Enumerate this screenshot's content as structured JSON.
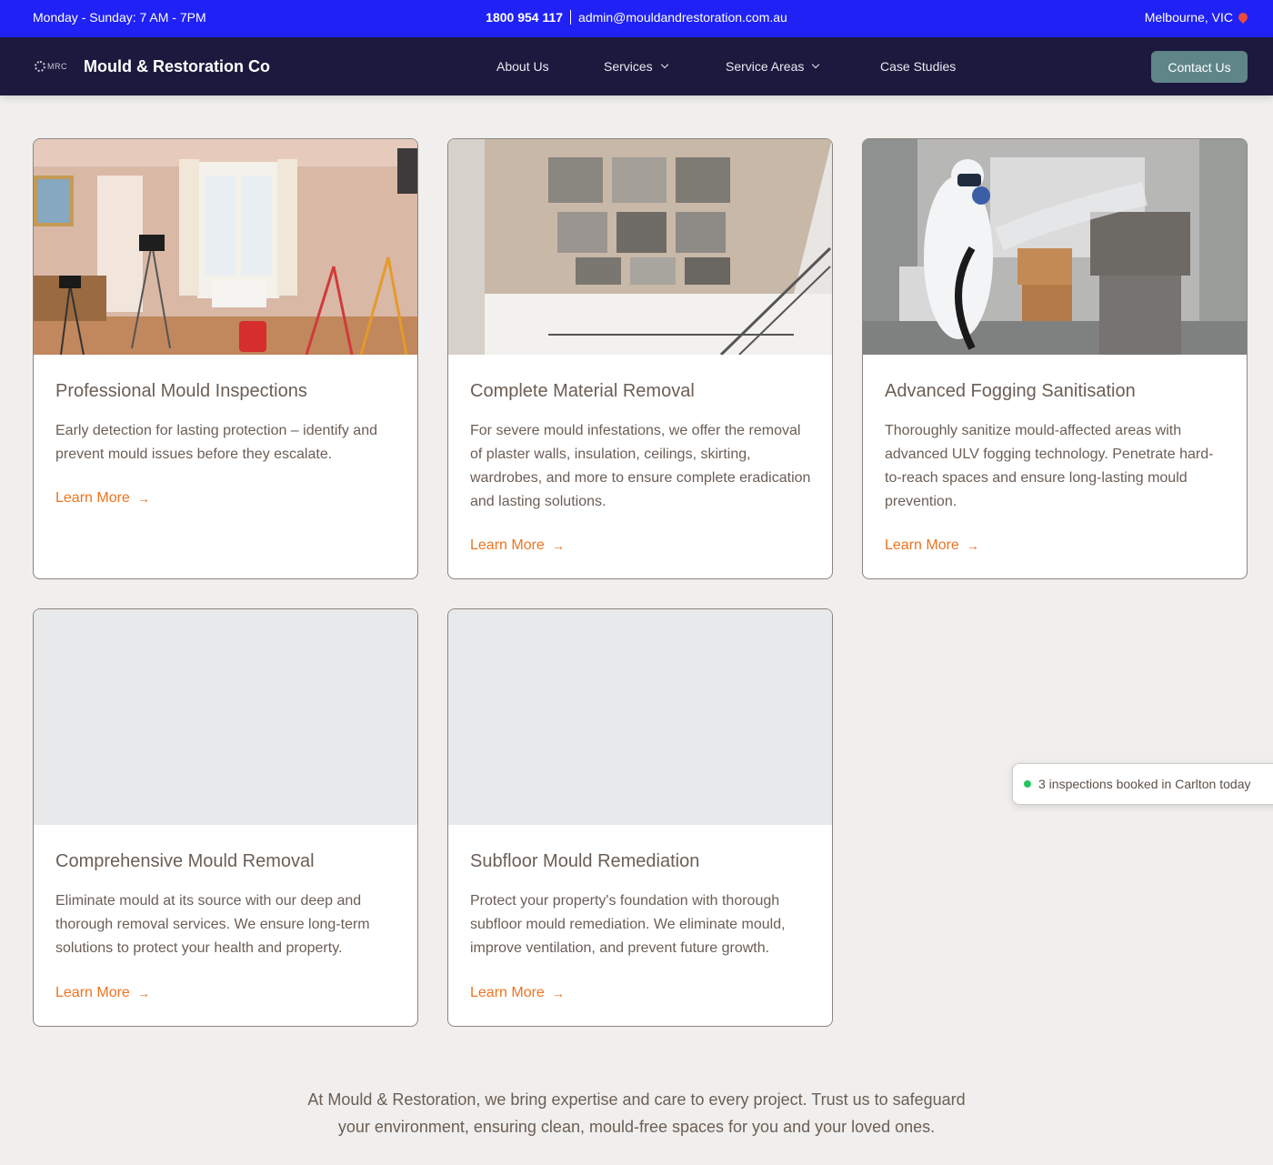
{
  "topbar": {
    "hours": "Monday - Sunday: 7 AM - 7PM",
    "phone": "1800 954 117",
    "email": "admin@mouldandrestoration.com.au",
    "location": "Melbourne, VIC"
  },
  "nav": {
    "logo_text": "MRC",
    "brand": "Mould & Restoration Co",
    "items": [
      {
        "label": "About Us"
      },
      {
        "label": "Services"
      },
      {
        "label": "Service Areas"
      },
      {
        "label": "Case Studies"
      }
    ],
    "cta": "Contact Us"
  },
  "cards": [
    {
      "title": "Professional Mould Inspections",
      "text": "Early detection for lasting protection – identify and prevent mould issues before they escalate.",
      "link": "Learn More"
    },
    {
      "title": "Complete Material Removal",
      "text": "For severe mould infestations, we offer the removal of plaster walls, insulation, ceilings, skirting, wardrobes, and more to ensure complete eradication and lasting solutions.",
      "link": "Learn More"
    },
    {
      "title": "Advanced Fogging Sanitisation",
      "text": "Thoroughly sanitize mould-affected areas with advanced ULV fogging technology. Penetrate hard-to-reach spaces and ensure long-lasting mould prevention.",
      "link": "Learn More"
    },
    {
      "title": "Comprehensive Mould Removal",
      "text": "Eliminate mould at its source with our deep and thorough removal services. We ensure long-term solutions to protect your health and property.",
      "link": "Learn More"
    },
    {
      "title": "Subfloor Mould Remediation",
      "text": "Protect your property's foundation with thorough subfloor mould remediation. We eliminate mould, improve ventilation, and prevent future growth.",
      "link": "Learn More"
    }
  ],
  "footer": {
    "text": "At Mould & Restoration, we bring expertise and care to every project. Trust us to safeguard your environment, ensuring clean, mould-free spaces for you and your loved ones."
  },
  "toast": {
    "text": "3 inspections booked in Carlton today"
  }
}
